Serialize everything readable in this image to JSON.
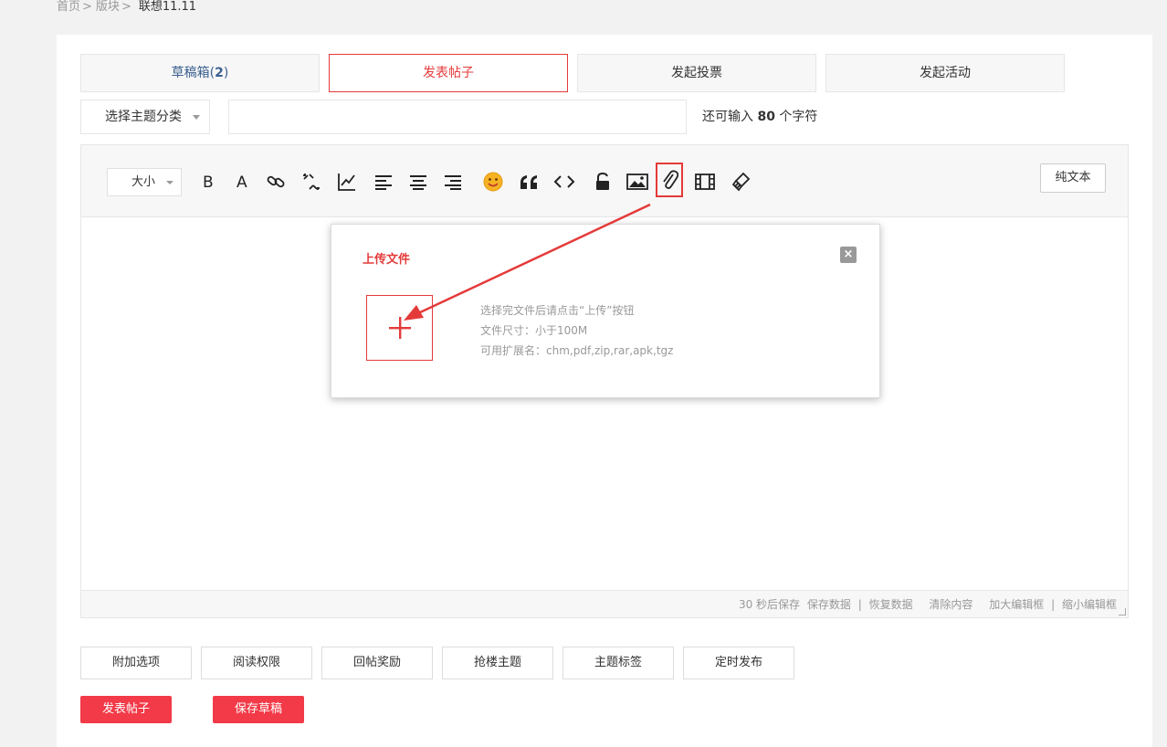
{
  "breadcrumb": {
    "home": "首页",
    "section": "版块",
    "current": "联想11.11",
    "sep": ">"
  },
  "tabs": {
    "draft_label": "草稿箱(",
    "draft_count": "2",
    "draft_close": ")",
    "post": "发表帖子",
    "poll": "发起投票",
    "event": "发起活动"
  },
  "category_select": {
    "selected": "选择主题分类"
  },
  "title_input": {
    "value": "",
    "placeholder": ""
  },
  "char_hint": {
    "prefix": "还可输入",
    "count": "80",
    "suffix": "个字符"
  },
  "editor": {
    "size_select": "大小",
    "plain_text_button": "纯文本",
    "toolbar_icons": [
      "bold-icon",
      "font-color-icon",
      "link-icon",
      "unlink-icon",
      "chart-icon",
      "align-left-icon",
      "align-center-icon",
      "align-right-icon",
      "emoji-icon",
      "quote-icon",
      "code-icon",
      "lock-icon",
      "image-icon",
      "attachment-icon",
      "video-icon",
      "clear-format-icon"
    ],
    "status": {
      "autosave": "30 秒后保存",
      "save": "保存数据",
      "divider": "|",
      "restore": "恢复数据",
      "clear": "清除内容",
      "enlarge": "加大编辑框",
      "shrink": "缩小编辑框"
    }
  },
  "upload_modal": {
    "title": "上传文件",
    "close": "×",
    "info": [
      "选择完文件后请点击“上传”按钮",
      "文件尺寸：小于100M",
      "可用扩展名：chm,pdf,zip,rar,apk,tgz"
    ]
  },
  "options": [
    "附加选项",
    "阅读权限",
    "回帖奖励",
    "抢楼主题",
    "主题标签",
    "定时发布"
  ],
  "actions": {
    "submit": "发表帖子",
    "save_draft": "保存草稿"
  },
  "colors": {
    "accent": "#e53a3a",
    "button": "#f23a48",
    "link_blue": "#3a5f8f"
  }
}
